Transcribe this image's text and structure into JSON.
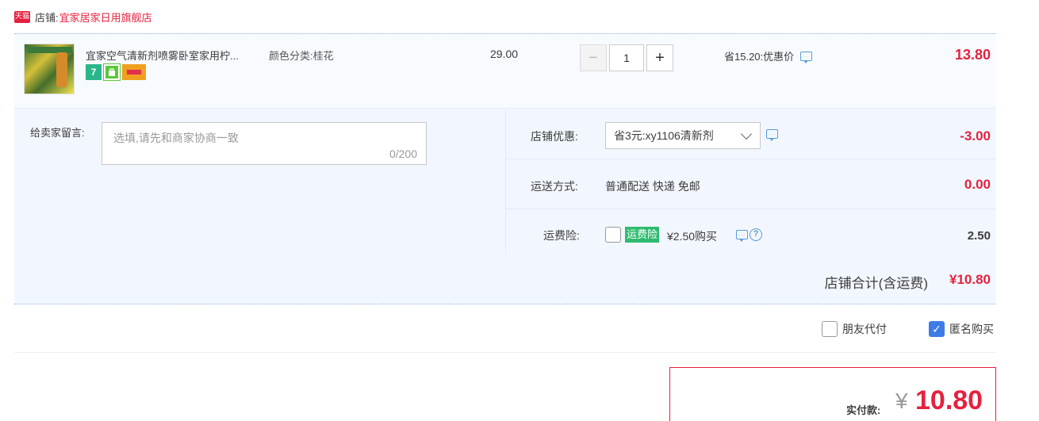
{
  "shop": {
    "badge": "天猫",
    "label": "店铺:",
    "name": "宜家居家日用旗舰店"
  },
  "item": {
    "title": "宜家空气清新剂喷雾卧室家用柠...",
    "spec": "颜色分类:桂花",
    "unit_price": "29.00",
    "quantity": "1",
    "minus": "−",
    "plus": "+",
    "promo_text": "省15.20:优惠价",
    "total": "13.80",
    "badges": [
      "7",
      "bag-icon",
      "card-icon"
    ]
  },
  "message": {
    "label": "给卖家留言:",
    "placeholder": "选填,请先和商家协商一致",
    "counter": "0/200"
  },
  "shop_coupon": {
    "label": "店铺优惠:",
    "selected": "省3元:xy1106清新剂",
    "amount": "-3.00"
  },
  "shipping": {
    "label": "运送方式:",
    "value": "普通配送 快递 免邮",
    "amount": "0.00"
  },
  "insurance": {
    "label": "运费险:",
    "tag": "运费险",
    "price": "¥2.50购买",
    "amount": "2.50",
    "checked": false
  },
  "subtotal": {
    "label": "店铺合计(含运费)",
    "value": "¥10.80"
  },
  "options": {
    "friend_pay": "朋友代付",
    "friend_pay_checked": false,
    "anonymous": "匿名购买",
    "anonymous_checked": true
  },
  "payment": {
    "label": "实付款:",
    "currency": "¥",
    "amount": "10.80"
  },
  "colors": {
    "accent_red": "#e5213f",
    "panel_bg": "#f2f7ff",
    "link_blue": "#5b9bd5",
    "check_blue": "#3d7be8",
    "insurance_green": "#2ebb6f"
  }
}
